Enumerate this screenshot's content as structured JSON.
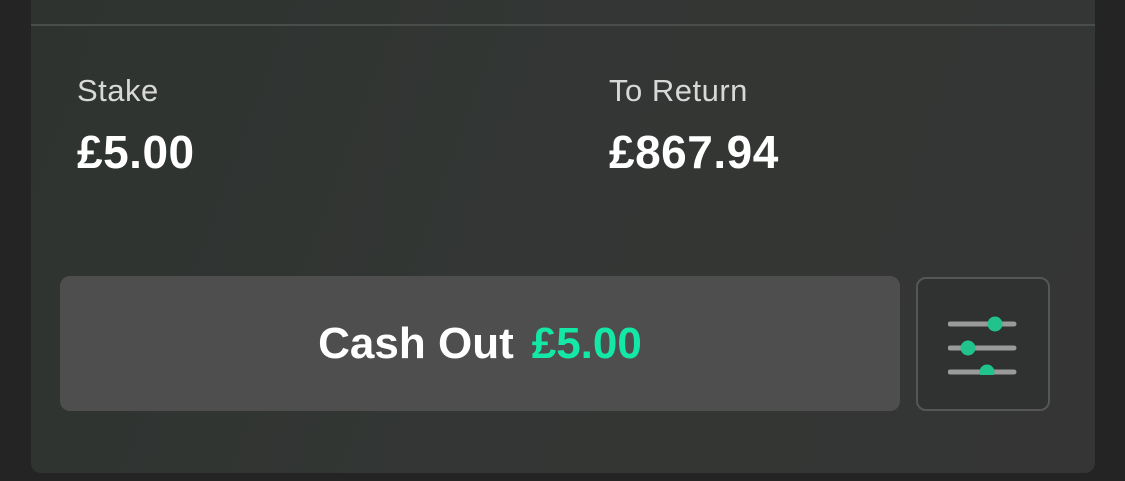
{
  "bet": {
    "stake_label": "Stake",
    "stake_value": "£5.00",
    "return_label": "To Return",
    "return_value": "£867.94"
  },
  "actions": {
    "cashout_label": "Cash Out",
    "cashout_amount": "£5.00",
    "settings_icon": "sliders-icon"
  },
  "colors": {
    "accent": "#14e8a6",
    "button_bg": "#4e4e4e",
    "card_bg": "#333634"
  }
}
